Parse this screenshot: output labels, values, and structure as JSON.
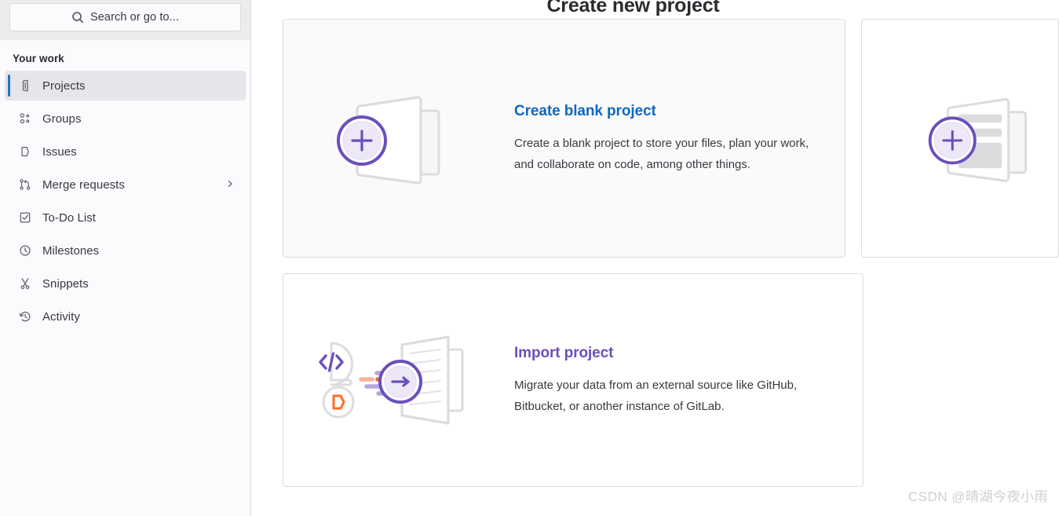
{
  "sidebar": {
    "search": {
      "placeholder": "Search or go to...",
      "icon": "search-icon"
    },
    "section_title": "Your work",
    "items": [
      {
        "label": "Projects",
        "icon": "project-icon",
        "active": true,
        "has_chevron": false
      },
      {
        "label": "Groups",
        "icon": "group-icon",
        "active": false,
        "has_chevron": false
      },
      {
        "label": "Issues",
        "icon": "issues-icon",
        "active": false,
        "has_chevron": false
      },
      {
        "label": "Merge requests",
        "icon": "merge-request-icon",
        "active": false,
        "has_chevron": true
      },
      {
        "label": "To-Do List",
        "icon": "todo-check-icon",
        "active": false,
        "has_chevron": false
      },
      {
        "label": "Milestones",
        "icon": "clock-icon",
        "active": false,
        "has_chevron": false
      },
      {
        "label": "Snippets",
        "icon": "scissors-icon",
        "active": false,
        "has_chevron": false
      },
      {
        "label": "Activity",
        "icon": "history-icon",
        "active": false,
        "has_chevron": false
      }
    ]
  },
  "main": {
    "title": "Create new project",
    "cards": [
      {
        "heading": "Create blank project",
        "description": "Create a blank project to store your files, plan your work, and collaborate on code, among other things.",
        "icon": "blank-project-illustration",
        "heading_color": "#1068bf"
      },
      {
        "heading": "Import project",
        "description": "Migrate your data from an external source like GitHub, Bitbucket, or another instance of GitLab.",
        "icon": "import-project-illustration",
        "heading_color": "#6b4fbb"
      },
      {
        "heading": "",
        "description": "",
        "icon": "template-project-illustration",
        "heading_color": ""
      }
    ]
  },
  "watermark": "CSDN @晴湖今夜小雨",
  "colors": {
    "accent_blue": "#1f75cb",
    "link_blue": "#1068bf",
    "purple": "#6b4fbb",
    "orange": "#fc6d26",
    "sidebar_bg": "#fbfafd",
    "sidebar_top_bg": "#ececef",
    "card_border": "#dcdcde"
  }
}
